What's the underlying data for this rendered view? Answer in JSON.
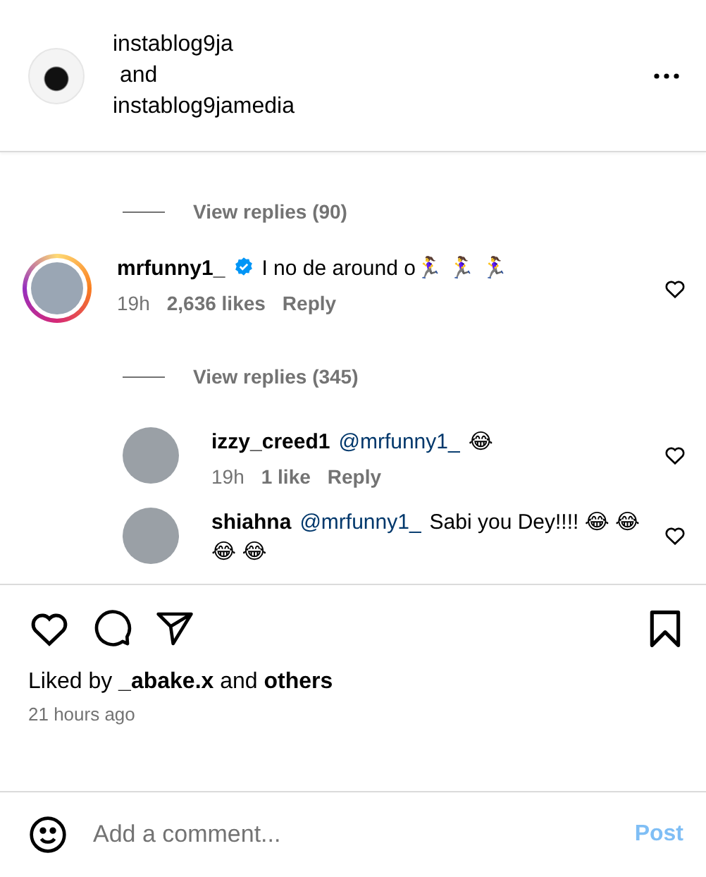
{
  "header": {
    "author": "instablog9ja",
    "joiner": "and",
    "coauthor": "instablog9jamedia"
  },
  "top_replies_link": "View replies (90)",
  "comments": [
    {
      "username": "mrfunny1_",
      "verified": true,
      "text": "I no de around o🏃‍♀️ 🏃‍♀️ 🏃‍♀️",
      "time": "19h",
      "likes": "2,636 likes",
      "reply": "Reply",
      "replies_link": "View replies (345)",
      "has_story": true,
      "replies": [
        {
          "username": "izzy_creed1",
          "mention": "@mrfunny1_",
          "text": "😂",
          "time": "19h",
          "likes": "1 like",
          "reply": "Reply",
          "has_story": false
        },
        {
          "username": "shiahna",
          "mention": "@mrfunny1_",
          "text": "Sabi you Dey!!!! 😂 😂 😂 😂",
          "has_story": false
        }
      ]
    }
  ],
  "liked_by": {
    "prefix": "Liked by",
    "user": "_abake.x",
    "joiner": "and",
    "others": "others"
  },
  "time_ago": "21 hours ago",
  "comment_box": {
    "placeholder": "Add a comment...",
    "post": "Post",
    "post_disabled": true
  }
}
